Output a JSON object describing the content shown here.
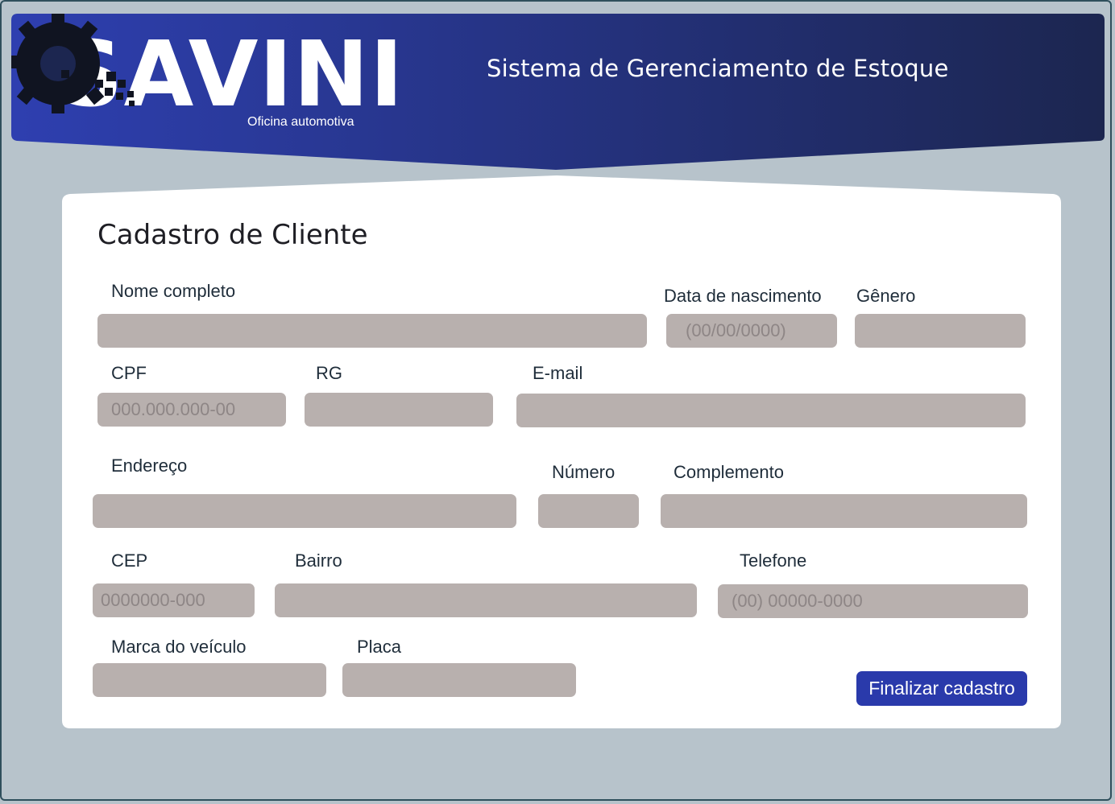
{
  "brand": {
    "logo": "SAVINI",
    "tagline": "Oficina automotiva",
    "system_title": "Sistema de Gerenciamento de Estoque",
    "colors": {
      "header_start": "#2e3fb0",
      "header_end": "#1c2650",
      "accent": "#2a3aab"
    }
  },
  "form": {
    "title": "Cadastro de Cliente",
    "fields": {
      "nome": {
        "label": "Nome completo",
        "placeholder": ""
      },
      "nascimento": {
        "label": "Data de nascimento",
        "placeholder": "(00/00/0000)"
      },
      "genero": {
        "label": "Gênero",
        "placeholder": ""
      },
      "cpf": {
        "label": "CPF",
        "placeholder": "000.000.000-00"
      },
      "rg": {
        "label": "RG",
        "placeholder": ""
      },
      "email": {
        "label": "E-mail",
        "placeholder": ""
      },
      "endereco": {
        "label": "Endereço",
        "placeholder": ""
      },
      "numero": {
        "label": "Número",
        "placeholder": ""
      },
      "complemento": {
        "label": "Complemento",
        "placeholder": ""
      },
      "cep": {
        "label": "CEP",
        "placeholder": "0000000-000"
      },
      "bairro": {
        "label": "Bairro",
        "placeholder": ""
      },
      "telefone": {
        "label": "Telefone",
        "placeholder": "(00) 00000-0000"
      },
      "marca": {
        "label": "Marca do veículo",
        "placeholder": ""
      },
      "placa": {
        "label": "Placa",
        "placeholder": ""
      }
    },
    "submit_label": "Finalizar cadastro"
  }
}
